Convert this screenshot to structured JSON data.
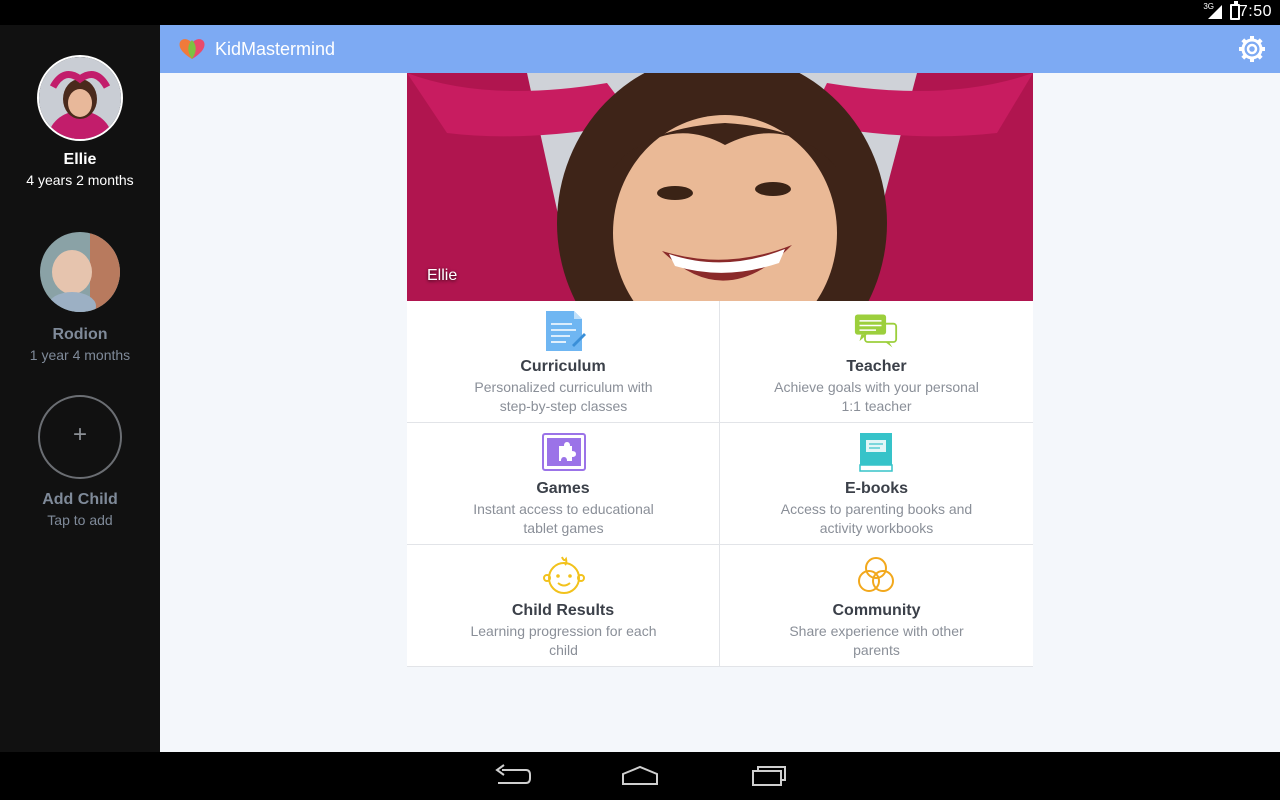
{
  "status_bar": {
    "network": "3G",
    "time": "7:50"
  },
  "app": {
    "title": "KidMastermind"
  },
  "sidebar": {
    "children": [
      {
        "name": "Ellie",
        "age": "4 years 2 months",
        "active": true
      },
      {
        "name": "Rodion",
        "age": "1 year 4 months",
        "active": false
      }
    ],
    "add_child": {
      "symbol": "+",
      "label": "Add Child",
      "hint": "Tap to add"
    }
  },
  "hero": {
    "label": "Ellie"
  },
  "tiles": [
    {
      "title": "Curriculum",
      "desc": "Personalized curriculum with step-by-step classes",
      "icon": "document-icon",
      "color": "#6fb6f2"
    },
    {
      "title": "Teacher",
      "desc": "Achieve goals with your personal 1:1 teacher",
      "icon": "chat-bubbles-icon",
      "color": "#9ccf3c"
    },
    {
      "title": "Games",
      "desc": "Instant access to educational tablet games",
      "icon": "puzzle-icon",
      "color": "#9b73e8"
    },
    {
      "title": "E-books",
      "desc": "Access to parenting books and activity workbooks",
      "icon": "book-icon",
      "color": "#36c3c9"
    },
    {
      "title": "Child Results",
      "desc": "Learning progression for each child",
      "icon": "baby-face-icon",
      "color": "#f2c21c"
    },
    {
      "title": "Community",
      "desc": "Share experience with other parents",
      "icon": "circles-icon",
      "color": "#f2a81c"
    }
  ],
  "colors": {
    "app_bar": "#7daaf3",
    "sidebar": "#111111",
    "background": "#f4f7fb"
  }
}
